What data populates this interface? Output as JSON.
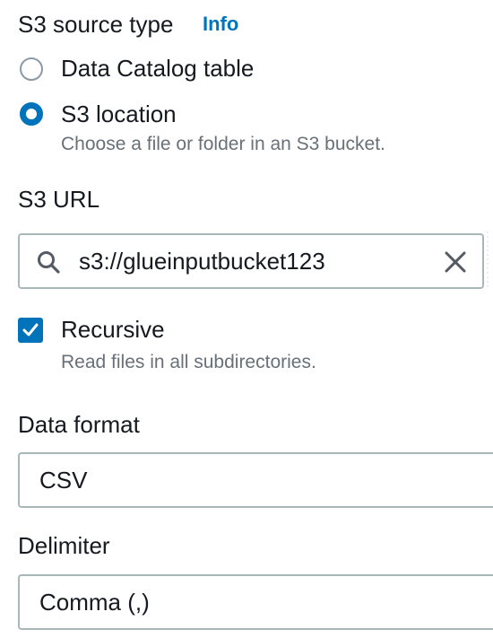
{
  "source_type": {
    "title": "S3 source type",
    "info_link": "Info",
    "options": [
      {
        "label": "Data Catalog table",
        "selected": false
      },
      {
        "label": "S3 location",
        "selected": true,
        "description": "Choose a file or folder in an S3 bucket."
      }
    ]
  },
  "s3_url": {
    "label": "S3 URL",
    "value": "s3://glueinputbucket123",
    "icons": [
      "search-icon",
      "clear-icon"
    ]
  },
  "recursive": {
    "label": "Recursive",
    "checked": true,
    "description": "Read files in all subdirectories."
  },
  "data_format": {
    "label": "Data format",
    "selected": "CSV"
  },
  "delimiter": {
    "label": "Delimiter",
    "selected": "Comma (,)"
  },
  "colors": {
    "accent": "#0073bb",
    "text": "#16191f",
    "secondary_text": "#687078",
    "border": "#aab7b8"
  }
}
